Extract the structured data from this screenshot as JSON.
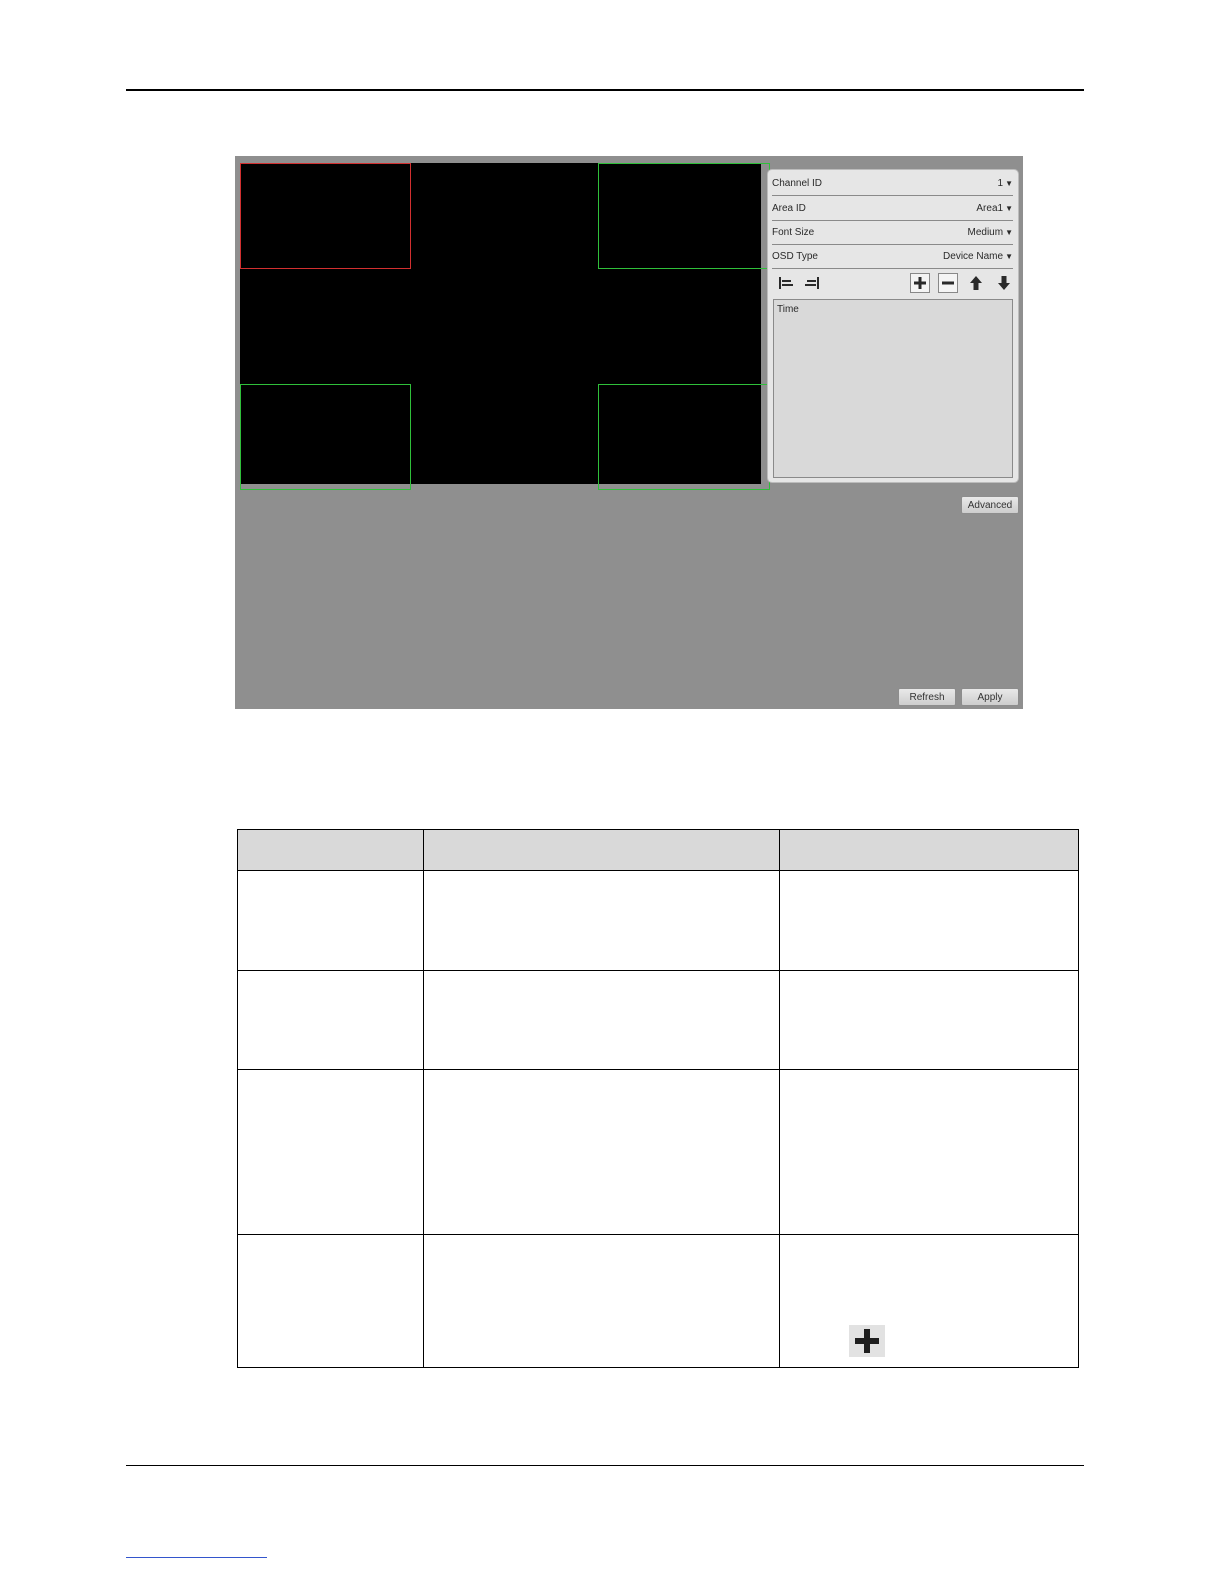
{
  "panel": {
    "channel_id": {
      "label": "Channel ID",
      "value": "1"
    },
    "area_id": {
      "label": "Area ID",
      "value": "Area1"
    },
    "font_size": {
      "label": "Font Size",
      "value": "Medium"
    },
    "osd_type": {
      "label": "OSD Type",
      "value": "Device Name"
    },
    "list_items": [
      "Time"
    ]
  },
  "buttons": {
    "advanced": "Advanced",
    "refresh": "Refresh",
    "apply": "Apply"
  },
  "icons": {
    "align_left": "align-left-icon",
    "align_right": "align-right-icon",
    "add": "plus-icon",
    "remove": "minus-icon",
    "move_up": "arrow-up-icon",
    "move_down": "arrow-down-icon"
  },
  "colors": {
    "selected_region": "#d23030",
    "region": "#2fbf3a"
  }
}
